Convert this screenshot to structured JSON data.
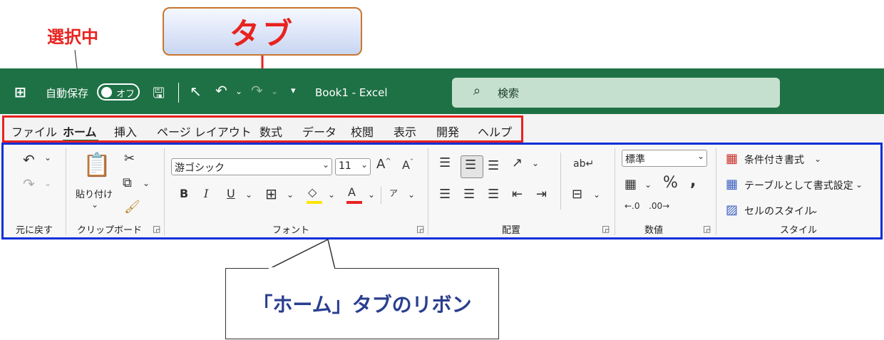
{
  "annotations": {
    "selected_label": "選択中",
    "tab_callout": "タブ",
    "ribbon_callout": "「ホーム」タブのリボン"
  },
  "titlebar": {
    "autosave_label": "自動保存",
    "autosave_state": "オフ",
    "document_title": "Book1 - Excel",
    "search_placeholder": "検索",
    "background": "#1e7145"
  },
  "tabs": [
    {
      "label": "ファイル"
    },
    {
      "label": "ホーム",
      "selected": true
    },
    {
      "label": "挿入"
    },
    {
      "label": "ページ レイアウト"
    },
    {
      "label": "数式"
    },
    {
      "label": "データ"
    },
    {
      "label": "校閲"
    },
    {
      "label": "表示"
    },
    {
      "label": "開発"
    },
    {
      "label": "ヘルプ"
    }
  ],
  "ribbon": {
    "undo_group": {
      "label": "元に戻す"
    },
    "clipboard_group": {
      "label": "クリップボード",
      "paste_label": "貼り付け"
    },
    "font_group": {
      "label": "フォント",
      "font_name": "游ゴシック",
      "font_size": "11"
    },
    "alignment_group": {
      "label": "配置"
    },
    "number_group": {
      "label": "数値",
      "format": "標準"
    },
    "style_group": {
      "label": "スタイル",
      "conditional_format": "条件付き書式",
      "format_as_table": "テーブルとして書式設定",
      "cell_styles": "セルのスタイル"
    }
  },
  "colors": {
    "annotation_red": "#e8231f",
    "ribbon_highlight_blue": "#0a2fd8",
    "excel_green": "#1e7145"
  }
}
